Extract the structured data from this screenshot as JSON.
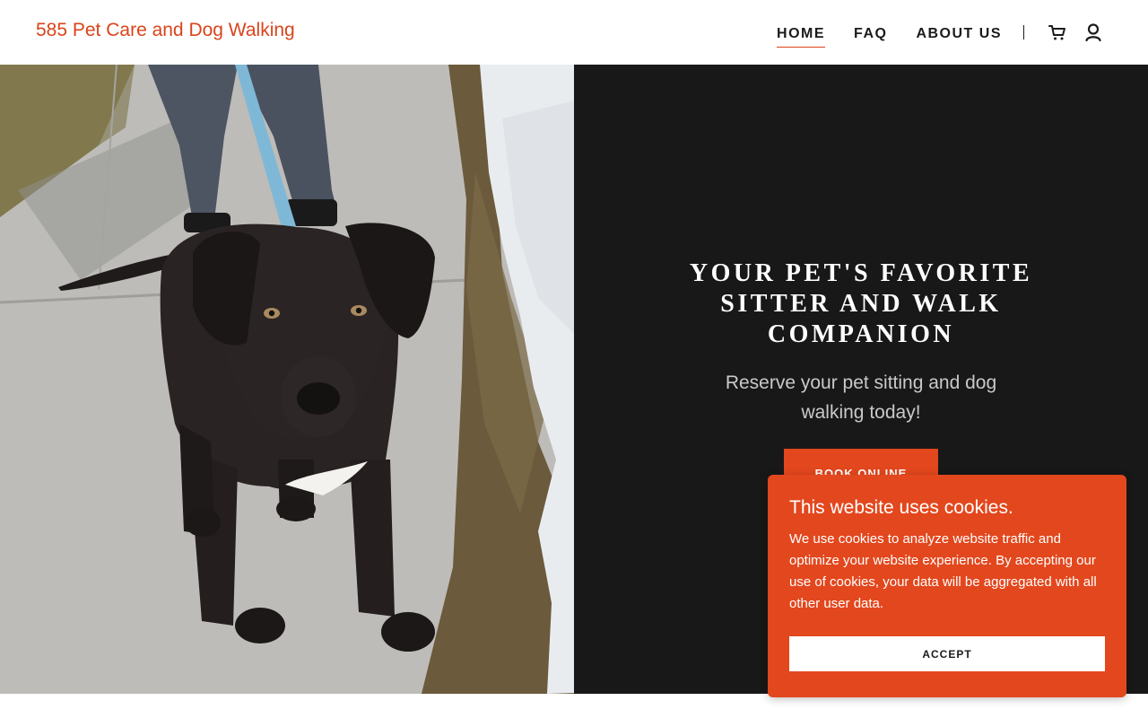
{
  "header": {
    "brand": "585 Pet Care and Dog Walking",
    "nav": [
      {
        "label": "HOME",
        "active": true
      },
      {
        "label": "FAQ",
        "active": false
      },
      {
        "label": "ABOUT US",
        "active": false
      }
    ],
    "icons": [
      "cart-icon",
      "account-icon"
    ]
  },
  "hero": {
    "photo": "black dog on leash standing on sidewalk",
    "title": "YOUR PET'S FAVORITE SITTER AND WALK COMPANION",
    "subtitle": "Reserve your pet sitting and dog walking today!",
    "cta": "BOOK ONLINE"
  },
  "cookie": {
    "title": "This website uses cookies.",
    "text": "We use cookies to analyze website traffic and optimize your website experience. By accepting our use of cookies, your data will be aggregated with all other user data.",
    "accept": "ACCEPT"
  },
  "colors": {
    "accent": "#e3471d",
    "brand_text": "#d9441b",
    "hero_panel": "#181818"
  }
}
